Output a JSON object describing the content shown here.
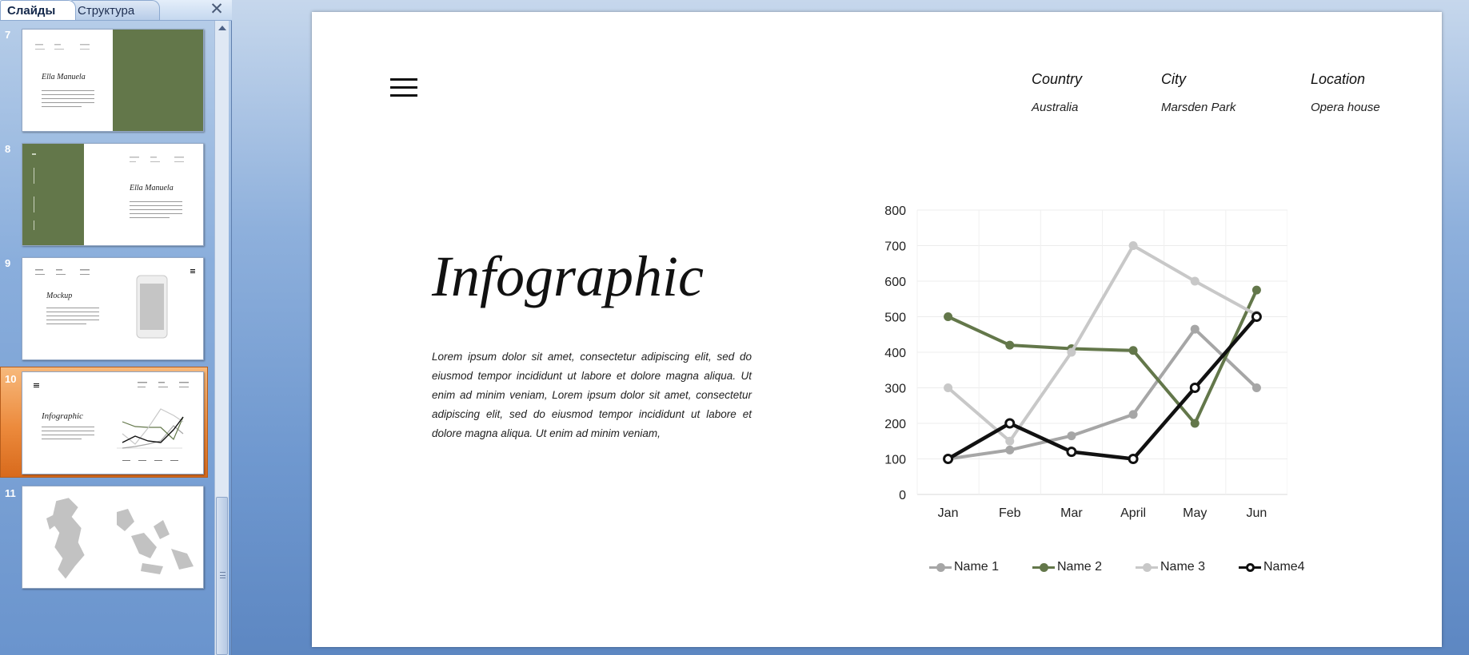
{
  "pane": {
    "tabs": [
      {
        "label": "Слайды",
        "active": true
      },
      {
        "label": "Структура",
        "active": false
      }
    ],
    "close_icon": "close-icon",
    "thumbnails": [
      {
        "number": "7",
        "title": "Ella Manuela"
      },
      {
        "number": "8",
        "title": "Ella Manuela"
      },
      {
        "number": "9",
        "title": "Mockup"
      },
      {
        "number": "10",
        "title": "Infographic",
        "selected": true
      },
      {
        "number": "11",
        "title": ""
      }
    ]
  },
  "slide": {
    "menu_icon": "hamburger-menu-icon",
    "info": {
      "country": {
        "label": "Country",
        "value": "Australia"
      },
      "city": {
        "label": "City",
        "value": "Marsden Park"
      },
      "location": {
        "label": "Location",
        "value": "Opera house"
      }
    },
    "title": "Infographic",
    "body": "Lorem ipsum dolor sit amet, consectetur adipiscing elit, sed do eiusmod tempor incididunt ut labore et dolore magna aliqua. Ut enim ad minim veniam, Lorem ipsum dolor sit amet, consectetur adipiscing elit, sed do eiusmod tempor incididunt ut labore et dolore magna aliqua. Ut enim ad minim veniam,"
  },
  "chart_data": {
    "type": "line",
    "categories": [
      "Jan",
      "Feb",
      "Mar",
      "April",
      "May",
      "Jun"
    ],
    "ylim": [
      0,
      800
    ],
    "yticks": [
      "0",
      "100",
      "200",
      "300",
      "400",
      "500",
      "600",
      "700",
      "800"
    ],
    "grid": true,
    "legend_position": "bottom",
    "series": [
      {
        "name": "Name 1",
        "color": "#a6a6a6",
        "values": [
          100,
          125,
          165,
          225,
          465,
          300
        ]
      },
      {
        "name": "Name 2",
        "color": "#63774a",
        "values": [
          500,
          420,
          410,
          405,
          200,
          575
        ]
      },
      {
        "name": "Name 3",
        "color": "#c8c8c8",
        "values": [
          300,
          150,
          400,
          700,
          600,
          505
        ]
      },
      {
        "name": "Name4",
        "color": "#111111",
        "values": [
          100,
          200,
          120,
          100,
          300,
          500
        ]
      }
    ]
  }
}
